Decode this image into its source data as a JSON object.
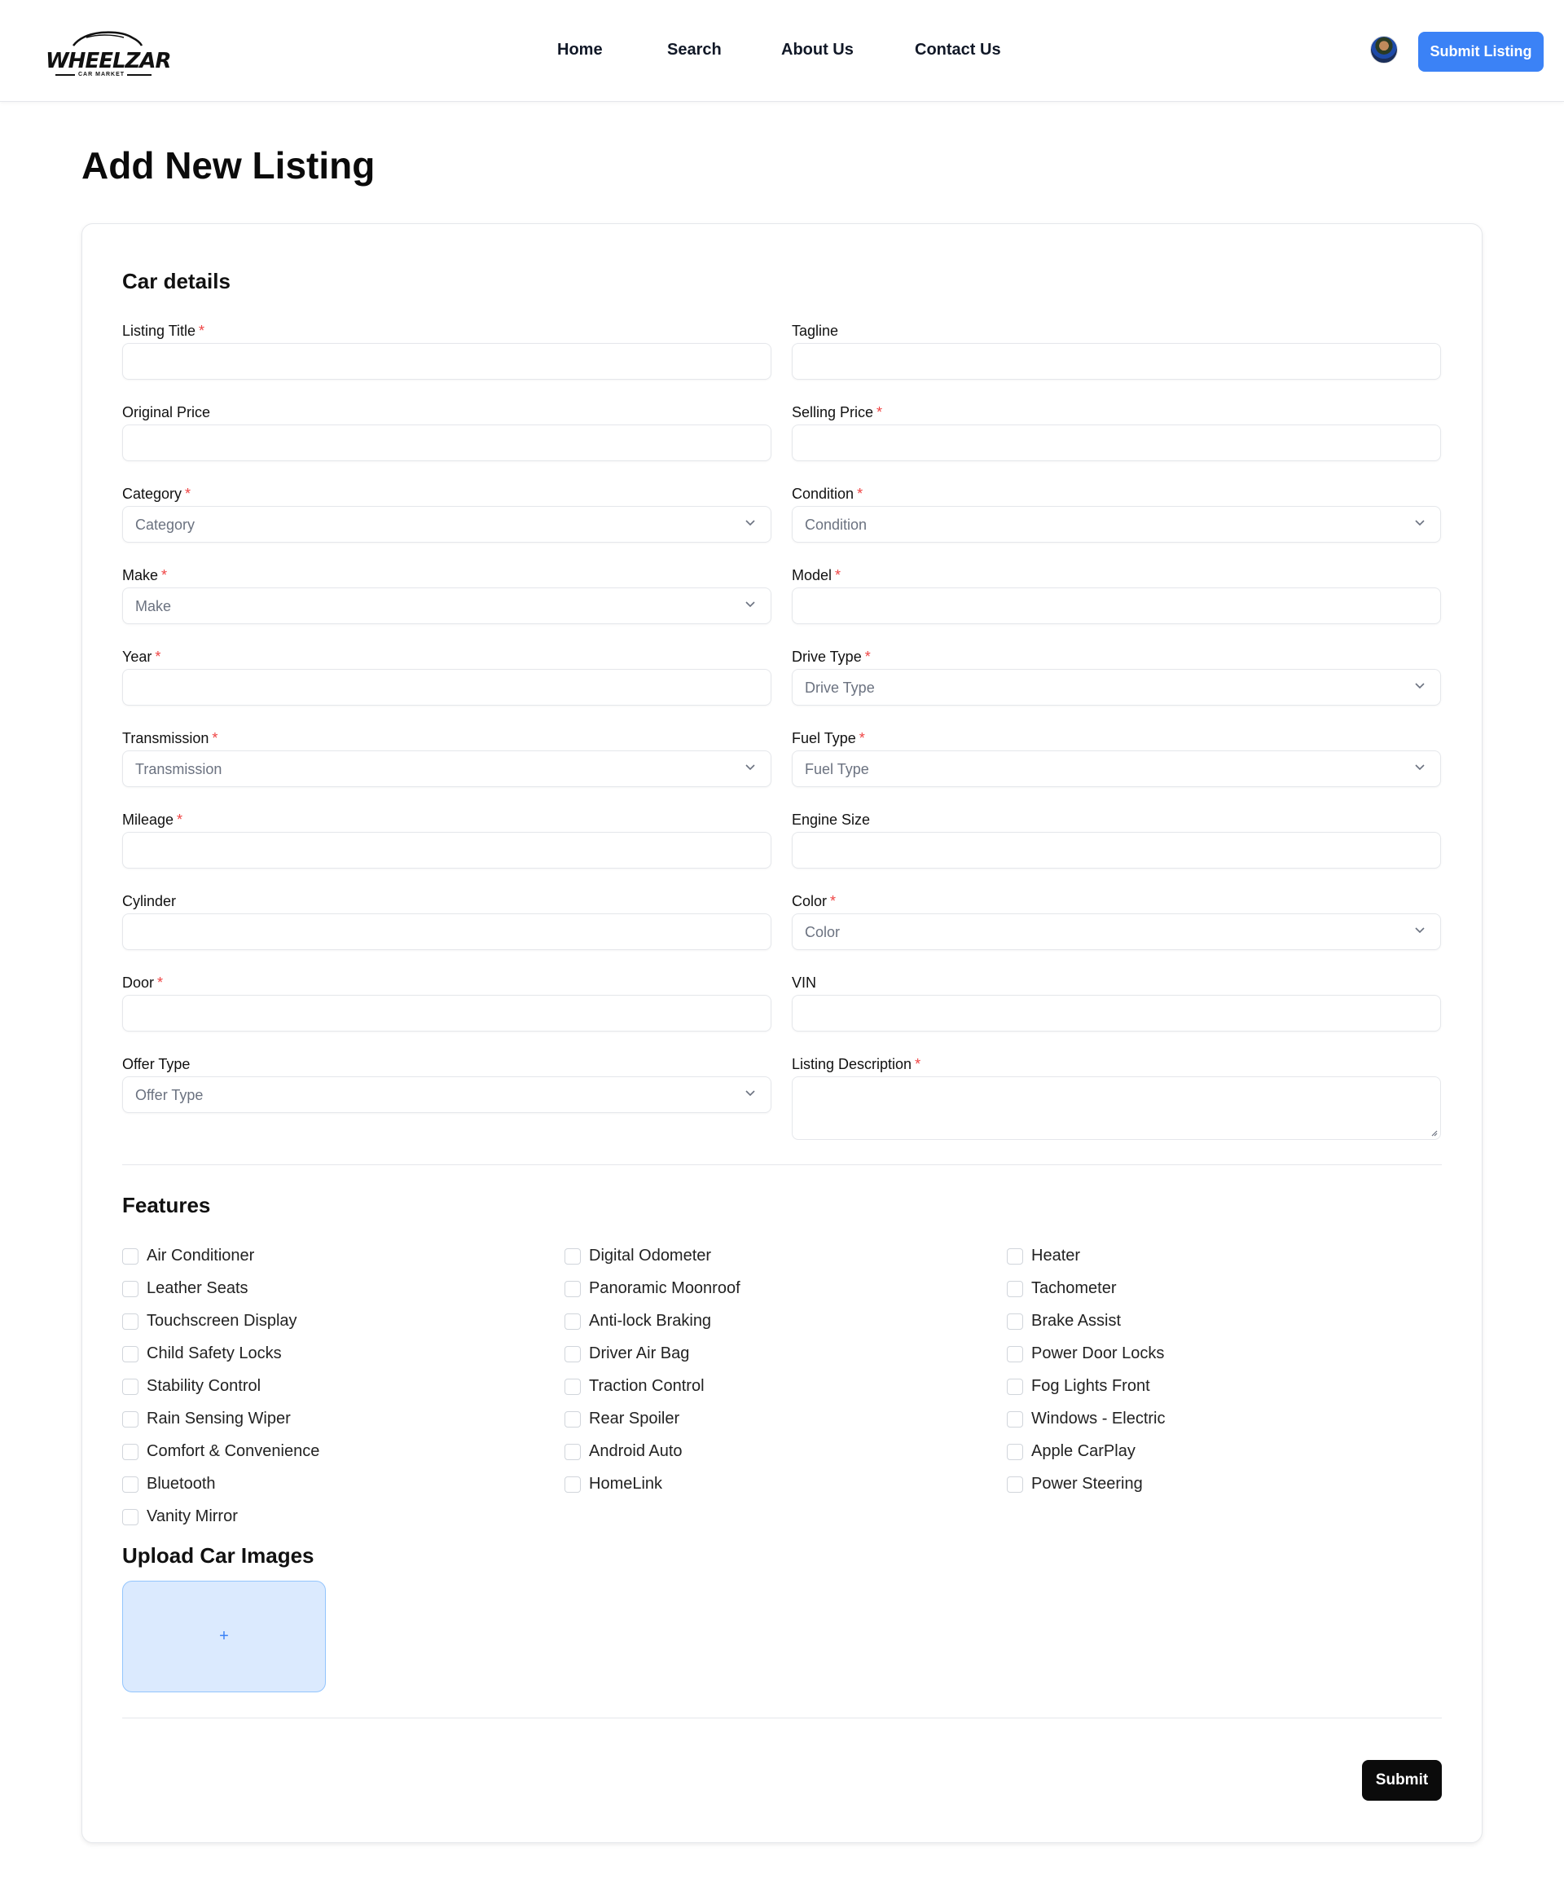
{
  "brand": {
    "logo_text": "WHEELZAR",
    "logo_subtext": "CAR MARKET"
  },
  "nav": {
    "home": "Home",
    "search": "Search",
    "about": "About Us",
    "contact": "Contact Us"
  },
  "header": {
    "submit_listing_label": "Submit Listing"
  },
  "page": {
    "title": "Add New Listing"
  },
  "form": {
    "car_details_title": "Car details",
    "fields": {
      "listing_title": {
        "label": "Listing Title",
        "required": "*"
      },
      "tagline": {
        "label": "Tagline"
      },
      "original_price": {
        "label": "Original Price"
      },
      "selling_price": {
        "label": "Selling Price",
        "required": "*"
      },
      "category": {
        "label": "Category",
        "required": "*",
        "placeholder": "Category"
      },
      "condition": {
        "label": "Condition",
        "required": "*",
        "placeholder": "Condition"
      },
      "make": {
        "label": "Make",
        "required": "*",
        "placeholder": "Make"
      },
      "model": {
        "label": "Model",
        "required": "*"
      },
      "year": {
        "label": "Year",
        "required": "*"
      },
      "drive_type": {
        "label": "Drive Type",
        "required": "*",
        "placeholder": "Drive Type"
      },
      "transmission": {
        "label": "Transmission",
        "required": "*",
        "placeholder": "Transmission"
      },
      "fuel_type": {
        "label": "Fuel Type",
        "required": "*",
        "placeholder": "Fuel Type"
      },
      "mileage": {
        "label": "Mileage",
        "required": "*"
      },
      "engine_size": {
        "label": "Engine Size"
      },
      "cylinder": {
        "label": "Cylinder"
      },
      "color": {
        "label": "Color",
        "required": "*",
        "placeholder": "Color"
      },
      "door": {
        "label": "Door",
        "required": "*"
      },
      "vin": {
        "label": "VIN"
      },
      "offer_type": {
        "label": "Offer Type",
        "placeholder": "Offer Type"
      },
      "listing_description": {
        "label": "Listing Description",
        "required": "*"
      }
    },
    "features_title": "Features",
    "features": [
      "Air Conditioner",
      "Digital Odometer",
      "Heater",
      "Leather Seats",
      "Panoramic Moonroof",
      "Tachometer",
      "Touchscreen Display",
      "Anti-lock Braking",
      "Brake Assist",
      "Child Safety Locks",
      "Driver Air Bag",
      "Power Door Locks",
      "Stability Control",
      "Traction Control",
      "Fog Lights Front",
      "Rain Sensing Wiper",
      "Rear Spoiler",
      "Windows - Electric",
      "Comfort & Convenience",
      "Android Auto",
      "Apple CarPlay",
      "Bluetooth",
      "HomeLink",
      "Power Steering",
      "Vanity Mirror"
    ],
    "upload_title": "Upload Car Images",
    "upload_plus": "+",
    "submit_label": "Submit"
  },
  "colors": {
    "primary": "#3b82f6",
    "required": "#ef4444",
    "submit_bg": "#0b0b0b",
    "upload_bg": "#dbeafe"
  }
}
